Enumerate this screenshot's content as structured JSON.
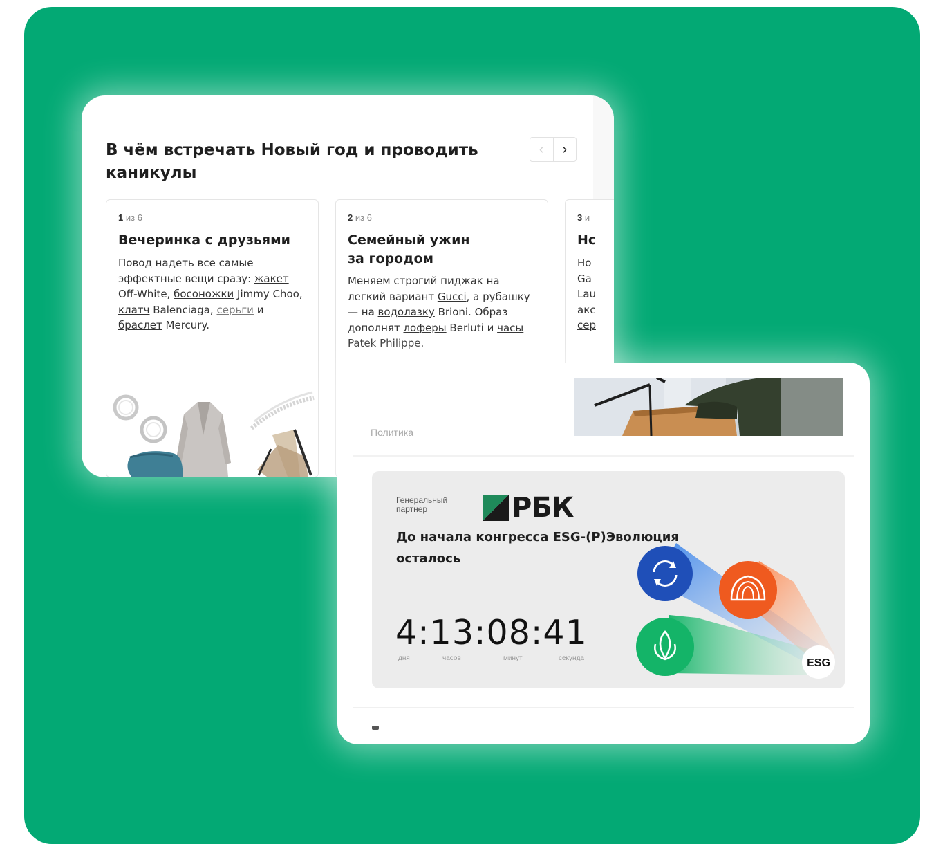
{
  "carousel": {
    "title": "В чём встречать Новый год и проводить каникулы",
    "nav_prev": "‹",
    "nav_next": "›",
    "slides": [
      {
        "counter_num": "1",
        "counter_total": "из 6",
        "title": "Вечеринка с друзьями",
        "desc": {
          "t1": "Повод надеть все самые эффектные вещи сразу: ",
          "l1": "жакет",
          "t2": " Off-White, ",
          "l2": "босоножки",
          "t3": " Jimmy Choo, ",
          "l3": "клатч",
          "t4": " Balenciaga, ",
          "l4": "серьги",
          "t5": " и ",
          "l5": "браслет",
          "t6": " Mercury."
        }
      },
      {
        "counter_num": "2",
        "counter_total": "из 6",
        "title": "Семейный ужин за городом",
        "desc": {
          "t1": "Меняем строгий пиджак на легкий вариант ",
          "l1": "Gucci",
          "t2": ", а рубашку — на ",
          "l2": "водолазку",
          "t3": " Brioni. Образ дополнят ",
          "l3": "лоферы",
          "t4": " Berluti и ",
          "l4": "часы",
          "t5": " Patek Philippe."
        }
      },
      {
        "counter_num": "3",
        "counter_total": "и",
        "title": "Нс",
        "lines": [
          "Но",
          "Ga",
          "Lau",
          "акс",
          "сер"
        ]
      }
    ]
  },
  "card2": {
    "section": "Политика",
    "partner_label": "Генеральный партнер",
    "logo": "РБК",
    "title": "До начала конгресса ESG-(Р)Эволюция осталось",
    "timer": "4:13:08:41",
    "units": [
      "дня",
      "часов",
      "минут",
      "секунда"
    ],
    "esg_label": "ESG",
    "colors": {
      "brand_green": "#03a974",
      "blue": "#1f4fb8",
      "orange": "#ef5a1f",
      "green": "#14b468"
    }
  }
}
